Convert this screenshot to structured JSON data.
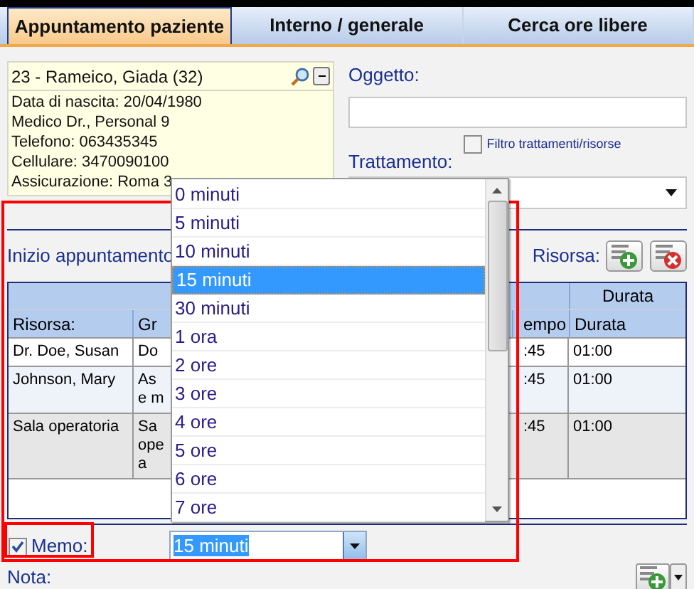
{
  "tabs": [
    {
      "label": "Appuntamento paziente",
      "selected": true
    },
    {
      "label": "Interno / generale",
      "selected": false
    },
    {
      "label": "Cerca ore libere",
      "selected": false
    }
  ],
  "patient": {
    "header": "23 - Rameico, Giada (32)",
    "details": [
      "Data di nascita: 20/04/1980",
      "Medico Dr., Personal 9",
      "Telefono:  063435345",
      "Cellulare: 3470090100",
      "Assicurazione: Roma 3"
    ]
  },
  "subject": {
    "label": "Oggetto:"
  },
  "filter": {
    "label": "Filtro trattamenti/risorse",
    "checked": false
  },
  "treatment": {
    "label": "Trattamento:"
  },
  "start_label": "Inizio appuntamento",
  "resource_label": "Risorsa:",
  "table": {
    "group_header": "Durata",
    "columns": [
      "Risorsa:",
      "Gr",
      "empo",
      "Durata"
    ],
    "rows": [
      {
        "cells": [
          "Dr. Doe, Susan",
          "Do",
          ":45",
          "01:00"
        ],
        "selected": false
      },
      {
        "cells": [
          "Johnson, Mary",
          "As\ne m",
          ":45",
          "01:00"
        ],
        "selected": false
      },
      {
        "cells": [
          "Sala operatoria",
          "Sa\nope\na",
          ":45",
          "01:00"
        ],
        "selected": true
      }
    ]
  },
  "memo": {
    "label": "Memo:",
    "checked": true
  },
  "duration": {
    "value": "15 minuti",
    "options": [
      {
        "label": "0 minuti",
        "selected": false
      },
      {
        "label": "5 minuti",
        "selected": false
      },
      {
        "label": "10 minuti",
        "selected": false
      },
      {
        "label": "15 minuti",
        "selected": true
      },
      {
        "label": "30 minuti",
        "selected": false
      },
      {
        "label": "1 ora",
        "selected": false
      },
      {
        "label": "2 ore",
        "selected": false
      },
      {
        "label": "3 ore",
        "selected": false
      },
      {
        "label": "4 ore",
        "selected": false
      },
      {
        "label": "5 ore",
        "selected": false
      },
      {
        "label": "6 ore",
        "selected": false
      },
      {
        "label": "7 ore",
        "selected": false
      }
    ]
  },
  "note_label": "Nota:"
}
